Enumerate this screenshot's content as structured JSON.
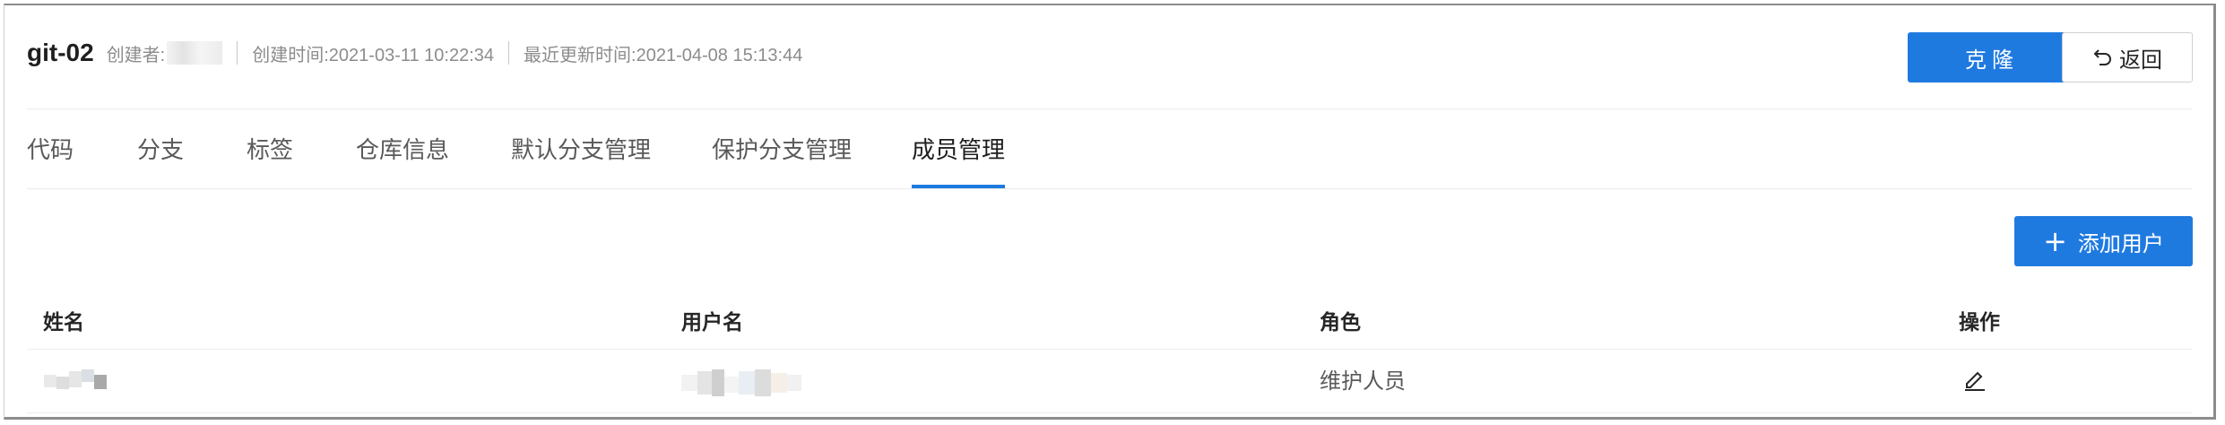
{
  "header": {
    "repo_name": "git-02",
    "creator_label": "创建者:",
    "created_time": "创建时间:2021-03-11 10:22:34",
    "updated_time": "最近更新时间:2021-04-08 15:13:44",
    "clone_label": "克隆",
    "back_label": "返回"
  },
  "tabs": [
    {
      "label": "代码",
      "active": false
    },
    {
      "label": "分支",
      "active": false
    },
    {
      "label": "标签",
      "active": false
    },
    {
      "label": "仓库信息",
      "active": false
    },
    {
      "label": "默认分支管理",
      "active": false
    },
    {
      "label": "保护分支管理",
      "active": false
    },
    {
      "label": "成员管理",
      "active": true
    }
  ],
  "toolbar": {
    "add_user_label": "添加用户"
  },
  "table": {
    "columns": [
      "姓名",
      "用户名",
      "角色",
      "操作"
    ],
    "rows": [
      {
        "role": "维护人员",
        "action_icon": "edit-icon"
      }
    ]
  },
  "colors": {
    "accent": "#1f7ae0",
    "text": "#262626",
    "muted": "#8c8c8c"
  }
}
